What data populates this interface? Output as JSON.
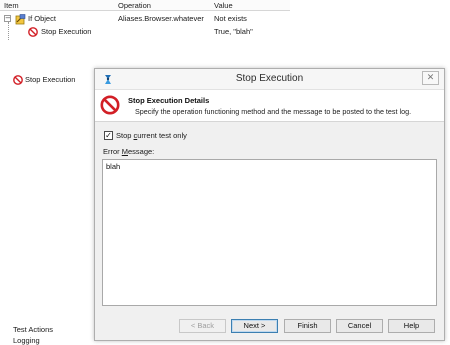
{
  "grid": {
    "columns": [
      "Item",
      "Operation",
      "Value"
    ],
    "rows": [
      {
        "item": "If Object",
        "operation": "Aliases.Browser.whatever",
        "value": "Not exists"
      },
      {
        "item": "Stop Execution",
        "operation": "",
        "value": "True, \"blah\""
      }
    ]
  },
  "background": {
    "stop_item": "Stop Execution",
    "test_actions": "Test Actions",
    "logging": "Logging"
  },
  "dialog": {
    "title": "Stop Execution",
    "close_symbol": "✕",
    "banner_title": "Stop Execution Details",
    "banner_subtitle": "Specify the operation functioning method and the message to be posted to the test log.",
    "checkbox_checked": true,
    "checkbox_pre": "Stop ",
    "checkbox_ul": "c",
    "checkbox_post": "urrent test only",
    "error_pre": "Error ",
    "error_ul": "M",
    "error_post": "essage:",
    "error_value": "blah",
    "buttons": {
      "back": "< Back",
      "next": "Next >",
      "finish": "Finish",
      "cancel": "Cancel",
      "help": "Help"
    }
  },
  "icons": [
    "stop-icon",
    "if-object-icon",
    "app-icon",
    "close-icon"
  ],
  "colors": {
    "stop_red": "#d21f26",
    "accent_blue": "#3c7fb1"
  }
}
